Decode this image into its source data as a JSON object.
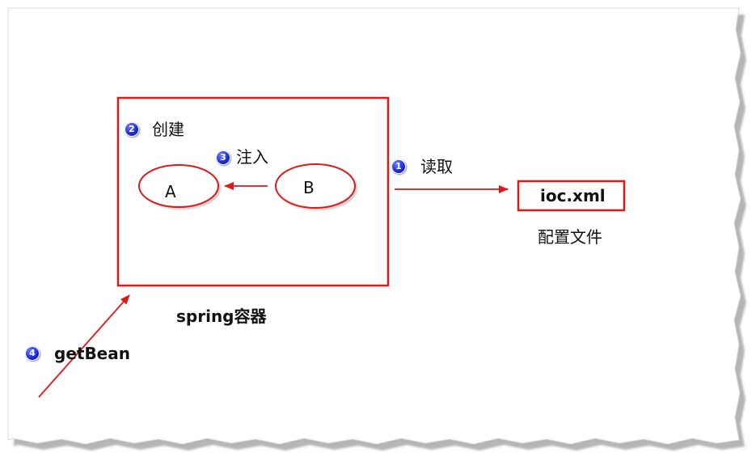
{
  "diagram": {
    "container_label": "spring容器",
    "step1": {
      "number": "1",
      "label": "读取"
    },
    "step2": {
      "number": "2",
      "label": "创建"
    },
    "step3": {
      "number": "3",
      "label": "注入"
    },
    "step4": {
      "number": "4",
      "label": "getBean"
    },
    "bean_a": "A",
    "bean_b": "B",
    "config_file": "ioc.xml",
    "config_caption": "配置文件"
  },
  "colors": {
    "stroke_red": "#e01818",
    "badge_blue": "#1a2ad0",
    "text": "#111111",
    "shadow": "#9a9a9a"
  }
}
